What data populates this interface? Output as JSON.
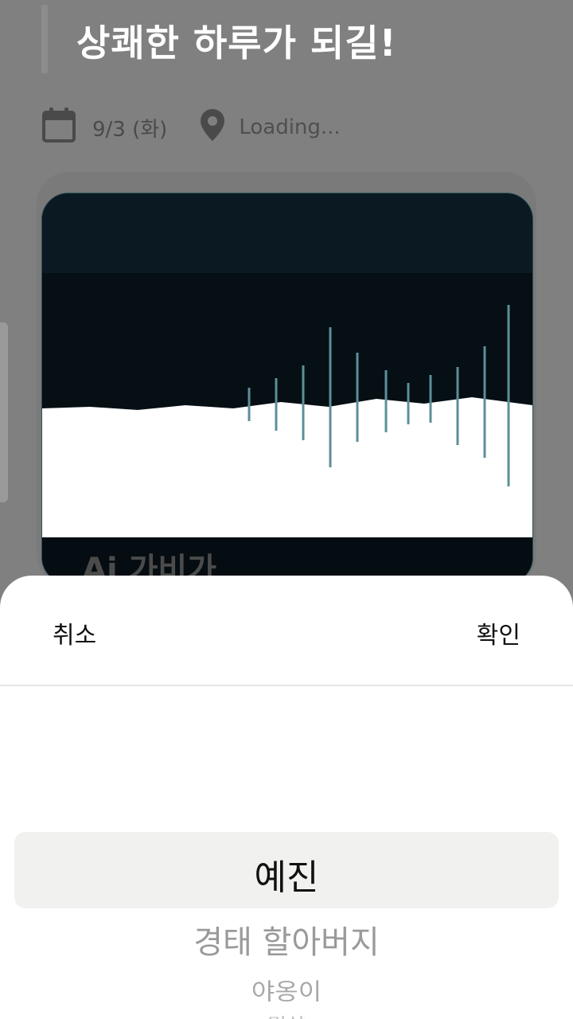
{
  "header": {
    "title": "상쾌한 하루가 되길!"
  },
  "meta": {
    "date": "9/3 (화)",
    "location": "Loading..."
  },
  "card": {
    "title": "Ai 가비가"
  },
  "sheet": {
    "cancel_label": "취소",
    "confirm_label": "확인",
    "options": [
      "예진",
      "경태 할아버지",
      "야옹이",
      "민상"
    ],
    "selected": "예진"
  },
  "icons": {
    "calendar": "calendar-icon",
    "location": "location-pin-icon"
  }
}
